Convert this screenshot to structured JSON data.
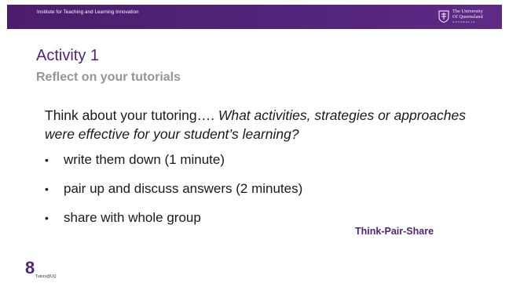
{
  "header": {
    "institute": "Institute for Teaching and Learning Innovation",
    "logo": {
      "icon": "uq-crest-icon",
      "line1": "The University",
      "line2": "Of Queensland",
      "line3": "AUSTRALIA"
    }
  },
  "slide": {
    "title": "Activity 1",
    "subtitle": "Reflect on your tutorials",
    "intro_plain": "Think about your tutoring…. ",
    "intro_italic": "What activities, strategies or approaches were effective for your student’s learning?",
    "bullet_symbol": "•",
    "bullets": [
      "write them down (1 minute)",
      "pair up and discuss answers (2 minutes)",
      "share with whole group"
    ],
    "method": "Think-Pair-Share"
  },
  "footer": {
    "page_number": "8",
    "label": "Tutors@UQ"
  },
  "colors": {
    "brand_purple": "#51247a",
    "subtitle_gray": "#969696"
  }
}
